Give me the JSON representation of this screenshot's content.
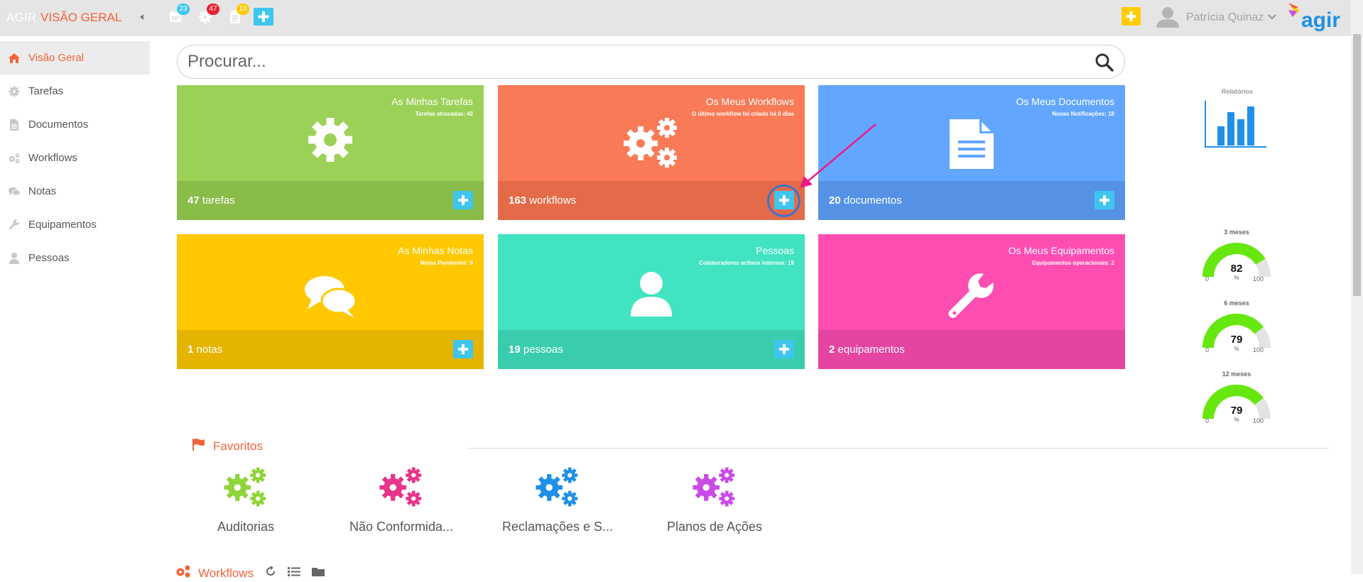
{
  "header": {
    "brand": "AGIR",
    "title": "VISÃO GERAL",
    "calendar_badge": "23",
    "settings_badge": "47",
    "clipboard_badge": "18",
    "user_name": "Patrícia Quinaz",
    "logo_text": "agir"
  },
  "colors": {
    "accent": "#f4623a",
    "add_button": "#3ec6ef",
    "green_tile": "#9bd156",
    "orange_tile": "#f97a56",
    "blue_tile": "#62a6ff",
    "yellow_tile": "#ffc800",
    "teal_tile": "#41e3c0",
    "pink_tile": "#ff4db2"
  },
  "sidebar": {
    "items": [
      {
        "label": "Visão Geral",
        "icon": "home-icon"
      },
      {
        "label": "Tarefas",
        "icon": "gear-icon"
      },
      {
        "label": "Documentos",
        "icon": "document-icon"
      },
      {
        "label": "Workflows",
        "icon": "gears-icon"
      },
      {
        "label": "Notas",
        "icon": "comments-icon"
      },
      {
        "label": "Equipamentos",
        "icon": "wrench-icon"
      },
      {
        "label": "Pessoas",
        "icon": "user-icon"
      }
    ]
  },
  "search": {
    "placeholder": "Procurar..."
  },
  "tiles": [
    {
      "title": "As Minhas Tarefas",
      "subtitle": "Tarefas atrasadas: 42",
      "count": "47",
      "unit": "tarefas",
      "icon": "gear-icon"
    },
    {
      "title": "Os Meus Workflows",
      "subtitle": "O último workflow foi criado há 0 dias",
      "count": "163",
      "unit": "workflows",
      "icon": "gears-icon"
    },
    {
      "title": "Os Meus Documentos",
      "subtitle": "Novas Notificações: 18",
      "count": "20",
      "unit": "documentos",
      "icon": "document-icon"
    },
    {
      "title": "As Minhas Notas",
      "subtitle": "Notas Pendentes: 0",
      "count": "1",
      "unit": "notas",
      "icon": "comments-icon"
    },
    {
      "title": "Pessoas",
      "subtitle": "Colaboradores activos internos: 19",
      "count": "19",
      "unit": "pessoas",
      "icon": "user-icon"
    },
    {
      "title": "Os Meus Equipamentos",
      "subtitle": "Equipamentos operacionais: 2",
      "count": "2",
      "unit": "equipamentos",
      "icon": "wrench-icon"
    }
  ],
  "reports": {
    "title": "Relatórios"
  },
  "gauges": [
    {
      "title": "3 meses",
      "value": 82,
      "display": "82",
      "min": "0",
      "max": "100",
      "unit": "%"
    },
    {
      "title": "6 meses",
      "value": 79,
      "display": "79",
      "min": "0",
      "max": "100",
      "unit": "%"
    },
    {
      "title": "12 meses",
      "value": 79,
      "display": "79",
      "min": "0",
      "max": "100",
      "unit": "%"
    }
  ],
  "favorites": {
    "title": "Favoritos",
    "items": [
      {
        "label": "Auditorias",
        "color": "#8ed43a"
      },
      {
        "label": "Não Conformida...",
        "color": "#e8348a"
      },
      {
        "label": "Reclamações e S...",
        "color": "#1f90e8"
      },
      {
        "label": "Planos de Ações",
        "color": "#c94be6"
      }
    ]
  },
  "workflows_section": {
    "title": "Workflows"
  }
}
